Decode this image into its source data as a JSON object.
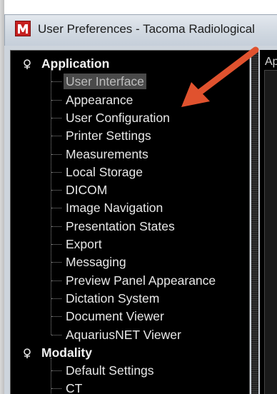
{
  "window": {
    "title": "User Preferences - Tacoma Radiological"
  },
  "right_panel": {
    "label": "Ap"
  },
  "tree": {
    "groups": [
      {
        "label": "Application",
        "items": [
          "User Interface",
          "Appearance",
          "User Configuration",
          "Printer Settings",
          "Measurements",
          "Local Storage",
          "DICOM",
          "Image Navigation",
          "Presentation States",
          "Export",
          "Messaging",
          "Preview Panel Appearance",
          "Dictation System",
          "Document Viewer",
          "AquariusNET Viewer"
        ],
        "selected_index": 0
      },
      {
        "label": "Modality",
        "items": [
          "Default Settings",
          "CT"
        ],
        "selected_index": -1
      }
    ]
  },
  "annotation": {
    "arrow_color": "#e0522e",
    "points_to": "User Configuration"
  },
  "colors": {
    "tree_background": "#000000",
    "selection_background": "#4a4a4a",
    "app_icon": "#c62020"
  },
  "icons": {
    "app": "radiology-app-icon",
    "expander": "pushpin-expander-icon"
  }
}
